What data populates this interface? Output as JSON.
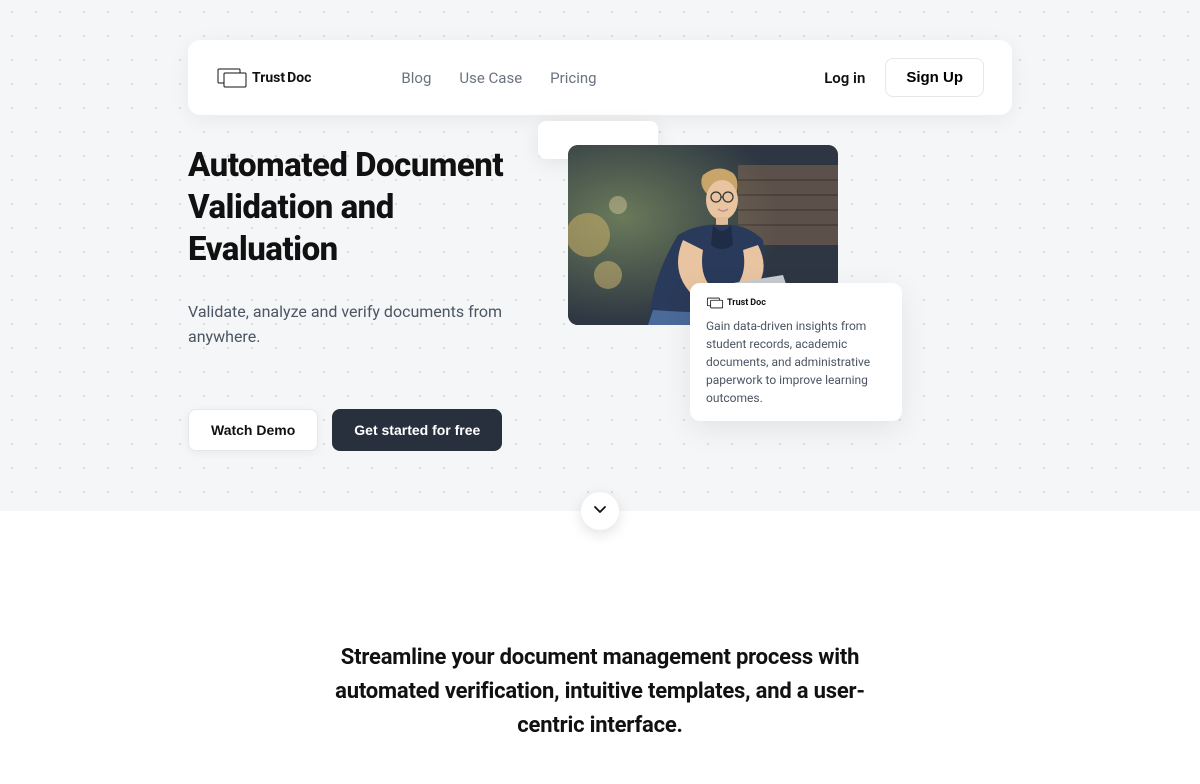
{
  "brand": {
    "name1": "Trust",
    "name2": "Doc"
  },
  "nav": {
    "links": [
      "Blog",
      "Use Case",
      "Pricing"
    ],
    "login": "Log in",
    "signup": "Sign Up"
  },
  "hero": {
    "title": "Automated Document Validation and Evaluation",
    "subtitle": "Validate, analyze and verify documents from anywhere.",
    "watch_demo": "Watch Demo",
    "get_started": "Get started for free"
  },
  "card": {
    "text": "Gain data-driven insights from student records, academic documents, and administrative paperwork to improve learning outcomes."
  },
  "section2": {
    "title": "Streamline your document management process with automated verification, intuitive templates, and a user-centric interface."
  },
  "colors": {
    "primary_dark": "#28303e",
    "text_muted": "#6b7280"
  }
}
